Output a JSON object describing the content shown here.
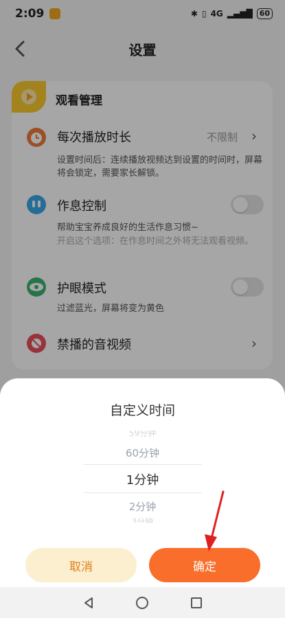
{
  "status": {
    "time": "2:09",
    "network": "4G",
    "battery": "60"
  },
  "header": {
    "title": "设置"
  },
  "card": {
    "title": "观看管理",
    "rows": [
      {
        "label": "每次播放时长",
        "value": "不限制",
        "desc": "设置时间后：连续播放视频达到设置的时间时，屏幕将会锁定，需要家长解锁。"
      },
      {
        "label": "作息控制",
        "desc": "帮助宝宝养成良好的生活作息习惯~",
        "desc2": "开启这个选项：在作息时间之外将无法观看视频。"
      },
      {
        "label": "护眼模式",
        "desc": "过滤蓝光，屏幕将变为黄色"
      },
      {
        "label": "禁播的音视频"
      }
    ]
  },
  "sheet": {
    "title": "自定义时间",
    "picker": {
      "prev2": "59分钟",
      "prev": "60分钟",
      "selected": "1分钟",
      "next": "2分钟",
      "next2": "3分钟"
    },
    "cancel": "取消",
    "confirm": "确定"
  },
  "colors": {
    "accent": "#f96e2a",
    "cancel_bg": "#fbefcf",
    "corner": "#f9c92f",
    "annotation": "#e02020"
  }
}
